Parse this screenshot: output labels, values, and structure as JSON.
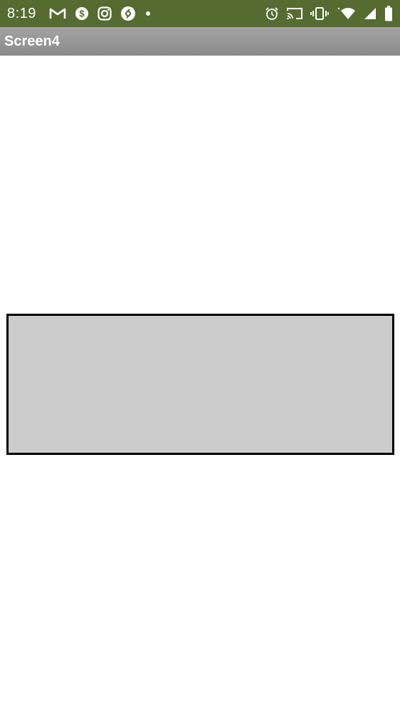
{
  "status_bar": {
    "time": "8:19",
    "background": "#556b2f",
    "left_icons": [
      "gmail-icon",
      "dollar-icon",
      "instagram-icon",
      "shazam-icon",
      "notification-dot-icon"
    ],
    "right_icons": [
      "alarm-icon",
      "cast-icon",
      "vibrate-icon",
      "wifi-icon",
      "cell-signal-icon",
      "battery-icon"
    ]
  },
  "title_bar": {
    "title": "Screen4"
  },
  "content": {
    "canvas_fill": "#cccccc",
    "canvas_border": "#000000"
  }
}
